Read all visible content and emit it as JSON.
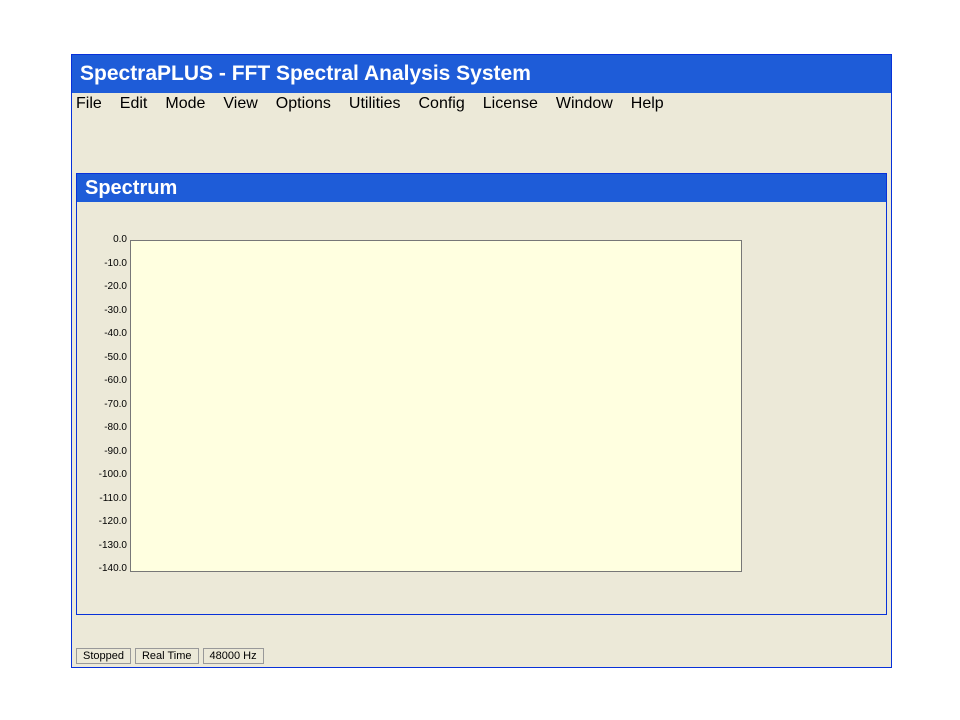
{
  "app": {
    "title": "SpectraPLUS - FFT Spectral Analysis System"
  },
  "menu": [
    "File",
    "Edit",
    "Mode",
    "View",
    "Options",
    "Utilities",
    "Config",
    "License",
    "Window",
    "Help"
  ],
  "spectrum": {
    "title": "Spectrum",
    "y_ticks": [
      "0.0",
      "-10.0",
      "-20.0",
      "-30.0",
      "-40.0",
      "-50.0",
      "-60.0",
      "-70.0",
      "-80.0",
      "-90.0",
      "-100.0",
      "-110.0",
      "-120.0",
      "-130.0",
      "-140.0"
    ]
  },
  "status": [
    "Stopped",
    "Real Time",
    "48000 Hz"
  ]
}
